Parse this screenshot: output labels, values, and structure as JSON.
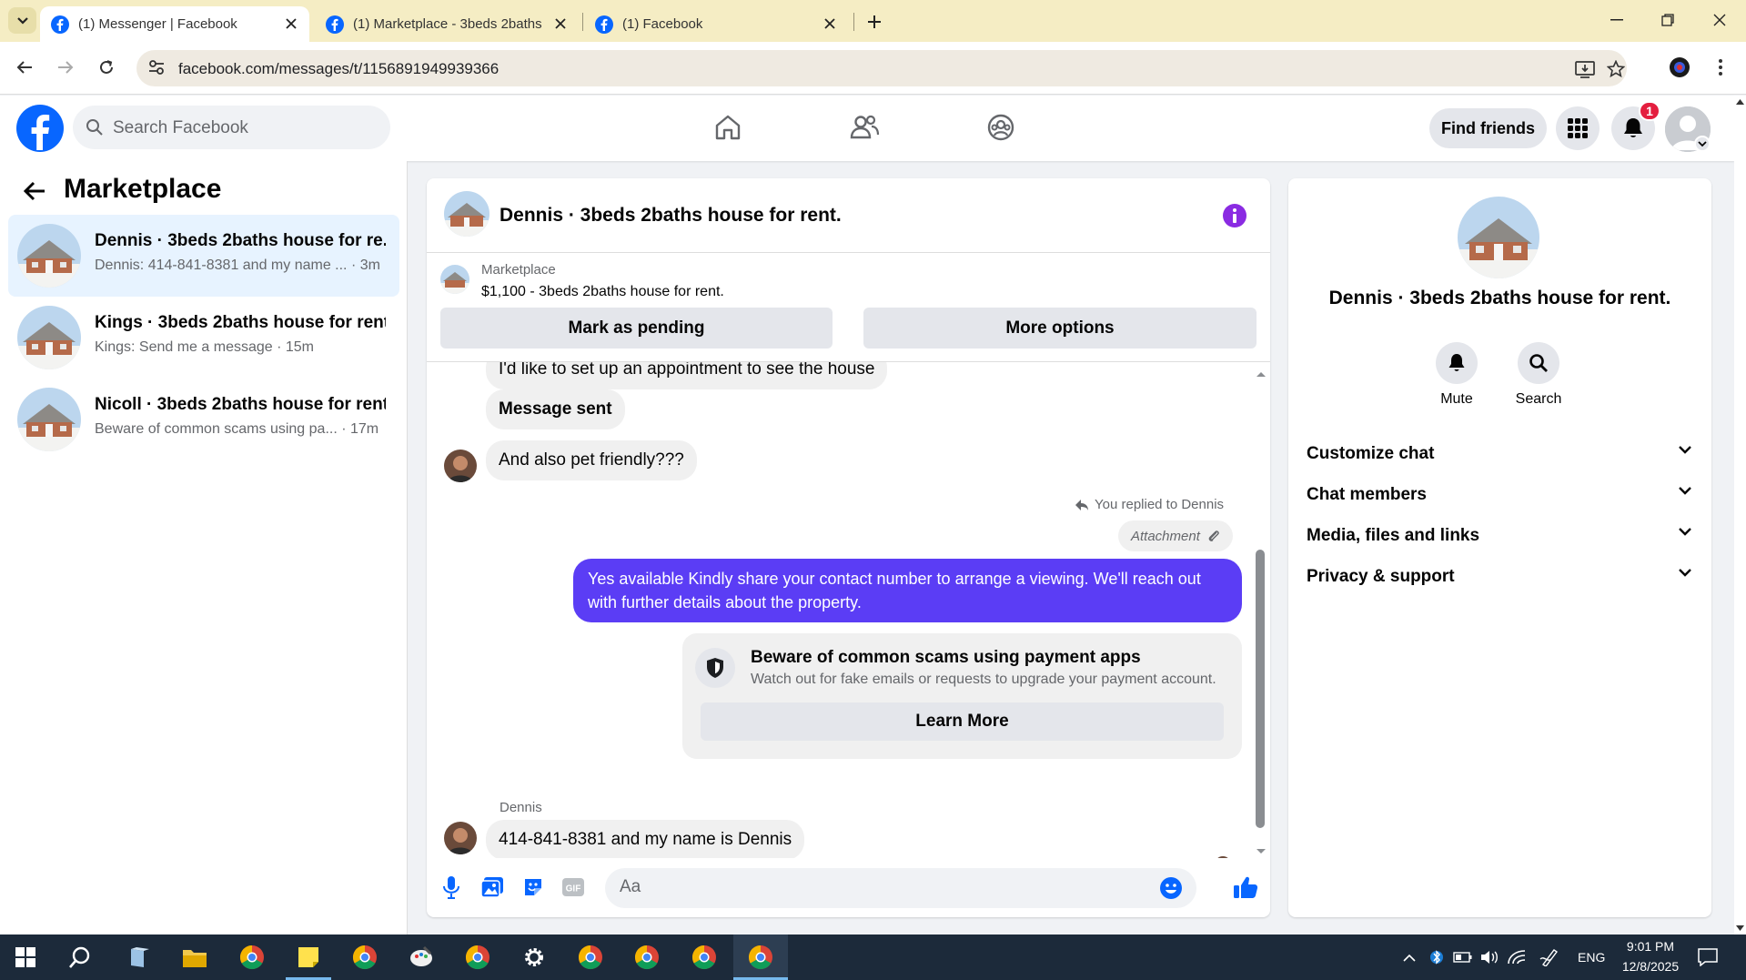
{
  "browser": {
    "tabs": [
      {
        "title": "(1) Messenger | Facebook",
        "active": true
      },
      {
        "title": "(1) Marketplace - 3beds 2baths",
        "active": false
      },
      {
        "title": "(1) Facebook",
        "active": false
      }
    ],
    "url": "facebook.com/messages/t/1156891949939366"
  },
  "fb_header": {
    "search_placeholder": "Search Facebook",
    "find_friends": "Find friends",
    "notification_count": "1"
  },
  "sidebar": {
    "title": "Marketplace",
    "conversations": [
      {
        "name": "Dennis · 3beds 2baths house for re...",
        "preview": "Dennis: 414-841-8381 and my name ... · 3m",
        "active": true
      },
      {
        "name": "Kings · 3beds 2baths house for rent.",
        "preview": "Kings: Send me a message · 15m",
        "active": false
      },
      {
        "name": "Nicoll · 3beds 2baths house for rent.",
        "preview": "Beware of common scams using pa... · 17m",
        "active": false
      }
    ]
  },
  "chat": {
    "title": "Dennis · 3beds 2baths house for rent.",
    "listing": {
      "source": "Marketplace",
      "detail": "$1,100 - 3beds 2baths house for rent."
    },
    "mark_pending": "Mark as pending",
    "more_options": "More options",
    "messages": {
      "m1": "I'd like to set up an appointment to see the house",
      "m2": "Message sent",
      "m3": "And also pet friendly???",
      "replied": "You replied to Dennis",
      "attachment": "Attachment",
      "out": "Yes available Kindly share your contact number to arrange a viewing. We'll reach out with further details about the property.",
      "scam_title": "Beware of common scams using payment apps",
      "scam_sub": "Watch out for fake emails or requests to upgrade your payment account.",
      "learn_more": "Learn More",
      "sender": "Dennis",
      "last": "414-841-8381 and my name is Dennis"
    },
    "composer_placeholder": "Aa"
  },
  "right_panel": {
    "name": "Dennis · 3beds 2baths house for rent.",
    "actions": [
      "Mute",
      "Search"
    ],
    "sections": [
      "Customize chat",
      "Chat members",
      "Media, files and links",
      "Privacy & support"
    ]
  },
  "taskbar": {
    "lang": "ENG",
    "time": "9:01 PM",
    "date": "12/8/2025"
  },
  "colors": {
    "accent": "#5b3df5",
    "fb_blue": "#0866ff",
    "active_conv": "#e7f3ff",
    "taskbar": "#1c2a3a"
  }
}
